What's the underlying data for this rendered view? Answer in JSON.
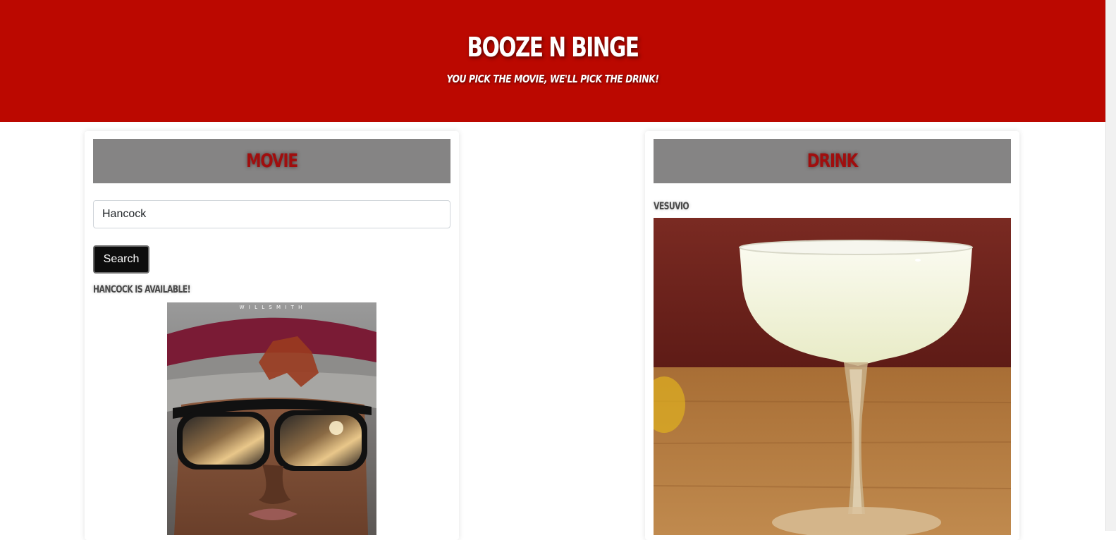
{
  "header": {
    "title": "BOOZE N BINGE",
    "tagline": "YOU PICK THE MOVIE, WE'LL PICK THE DRINK!"
  },
  "movie_card": {
    "heading": "MOVIE",
    "search_value": "Hancock",
    "search_button": "Search",
    "result_text": "HANCOCK IS AVAILABLE!",
    "poster_credit": "W I L L   S M I T H"
  },
  "drink_card": {
    "heading": "DRINK",
    "drink_name": "VESUVIO"
  },
  "colors": {
    "header_bg": "#bb0800",
    "card_header_bg": "#858484",
    "card_header_text": "#a00e0e",
    "button_bg": "#0d0d0d"
  }
}
